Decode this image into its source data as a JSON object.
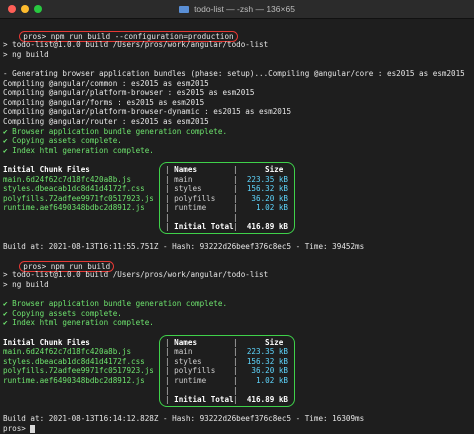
{
  "window": {
    "title": "todo-list — -zsh — 136×65",
    "traffic_colors": [
      "#ff5f57",
      "#febc2e",
      "#28c840"
    ]
  },
  "build1": {
    "prompt": "pros>",
    "command": "npm run build --configuration=production",
    "lines": [
      "> todo-list@1.0.0 build /Users/pros/work/angular/todo-list",
      "> ng build"
    ],
    "compile_lines": [
      "- Generating browser application bundles (phase: setup)...Compiling @angular/core : es2015 as esm2015",
      "Compiling @angular/common : es2015 as esm2015",
      "Compiling @angular/platform-browser : es2015 as esm2015",
      "Compiling @angular/forms : es2015 as esm2015",
      "Compiling @angular/platform-browser-dynamic : es2015 as esm2015",
      "Compiling @angular/router : es2015 as esm2015"
    ],
    "checks": [
      "✔ Browser application bundle generation complete.",
      "✔ Copying assets complete.",
      "✔ Index html generation complete."
    ],
    "chunk_header": "Initial Chunk Files",
    "files": [
      "main.6d24f62c7d18fc420a8b.js",
      "styles.dbeacab1dc8d41d4172f.css",
      "polyfills.72adfee9971fc0517923.js",
      "runtime.aef6490348bdbc2d8912.js"
    ],
    "table": {
      "names_header": "Names",
      "size_header": "Size",
      "names": [
        "main",
        "styles",
        "polyfills",
        "runtime"
      ],
      "sizes": [
        "223.35 kB",
        "156.32 kB",
        "36.20 kB",
        "1.02 kB"
      ],
      "total_label": "Initial Total",
      "total": "416.89 kB"
    },
    "build_at": "Build at: 2021-08-13T16:11:55.751Z - Hash: 93222d26beef376c8ec5 - Time: 39452ms"
  },
  "build2": {
    "prompt": "pros>",
    "command": "npm run build",
    "lines": [
      "> todo-list@1.0.0 build /Users/pros/work/angular/todo-list",
      "> ng build"
    ],
    "checks": [
      "✔ Browser application bundle generation complete.",
      "✔ Copying assets complete.",
      "✔ Index html generation complete."
    ],
    "chunk_header": "Initial Chunk Files",
    "files": [
      "main.6d24f62c7d18fc420a8b.js",
      "styles.dbeacab1dc8d41d4172f.css",
      "polyfills.72adfee9971fc0517923.js",
      "runtime.aef6490348bdbc2d8912.js"
    ],
    "table": {
      "names_header": "Names",
      "size_header": "Size",
      "names": [
        "main",
        "styles",
        "polyfills",
        "runtime"
      ],
      "sizes": [
        "223.35 kB",
        "156.32 kB",
        "36.20 kB",
        "1.02 kB"
      ],
      "total_label": "Initial Total",
      "total": "416.89 kB"
    },
    "build_at": "Build at: 2021-08-13T16:14:12.828Z - Hash: 93222d26beef376c8ec5 - Time: 16309ms"
  },
  "final_prompt": "pros>"
}
